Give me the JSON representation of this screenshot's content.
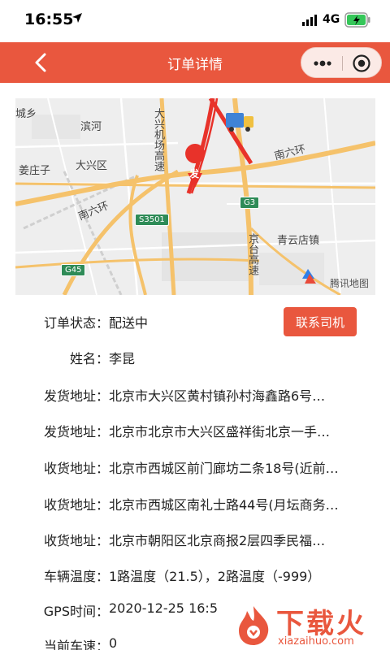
{
  "status_bar": {
    "time": "16:55",
    "network": "4G"
  },
  "nav": {
    "title": "订单详情"
  },
  "map": {
    "labels": {
      "city_town_left": "城乡",
      "binhe": "滨河",
      "daxing_airport_highway": "大兴机场高速",
      "jiangziwan": "姜庄子",
      "daxing_district": "大兴区",
      "south_sixth_ring_left": "南六环",
      "south_sixth_ring_right": "南六环",
      "qingyundian": "青云店镇",
      "jingtai_highway": "京台高速",
      "s3501": "S3501",
      "g45": "G45",
      "g3": "G3",
      "origin_marker": "发"
    },
    "provider": "腾讯地图"
  },
  "order": {
    "status": {
      "label": "订单状态：",
      "value": "配送中"
    },
    "name": {
      "label": "姓名：",
      "value": "李昆"
    },
    "ship_address_1": {
      "label": "发货地址：",
      "value": "北京市大兴区黄村镇孙村海鑫路6号…"
    },
    "ship_address_2": {
      "label": "发货地址：",
      "value": "北京市北京市大兴区盛祥街北京一手…"
    },
    "receive_address_1": {
      "label": "收货地址：",
      "value": "北京市西城区前门廊坊二条18号(近前…"
    },
    "receive_address_2": {
      "label": "收货地址：",
      "value": "北京市西城区南礼士路44号(月坛商务…"
    },
    "receive_address_3": {
      "label": "收货地址：",
      "value": "北京市朝阳区北京商报2层四季民福…"
    },
    "vehicle_temp": {
      "label": "车辆温度：",
      "value": "1路温度（21.5），2路温度（-999）"
    },
    "gps_time": {
      "label": "GPS时间：",
      "value": "2020-12-25 16:5"
    },
    "current_speed": {
      "label": "当前车速：",
      "value": "0"
    },
    "contact_button": "联系司机"
  },
  "watermark": {
    "title": "下载火",
    "site": "xiazaihuo.com"
  },
  "colors": {
    "brand": "#e9573e",
    "map_road": "#f5c26b",
    "route": "#e8322a"
  }
}
